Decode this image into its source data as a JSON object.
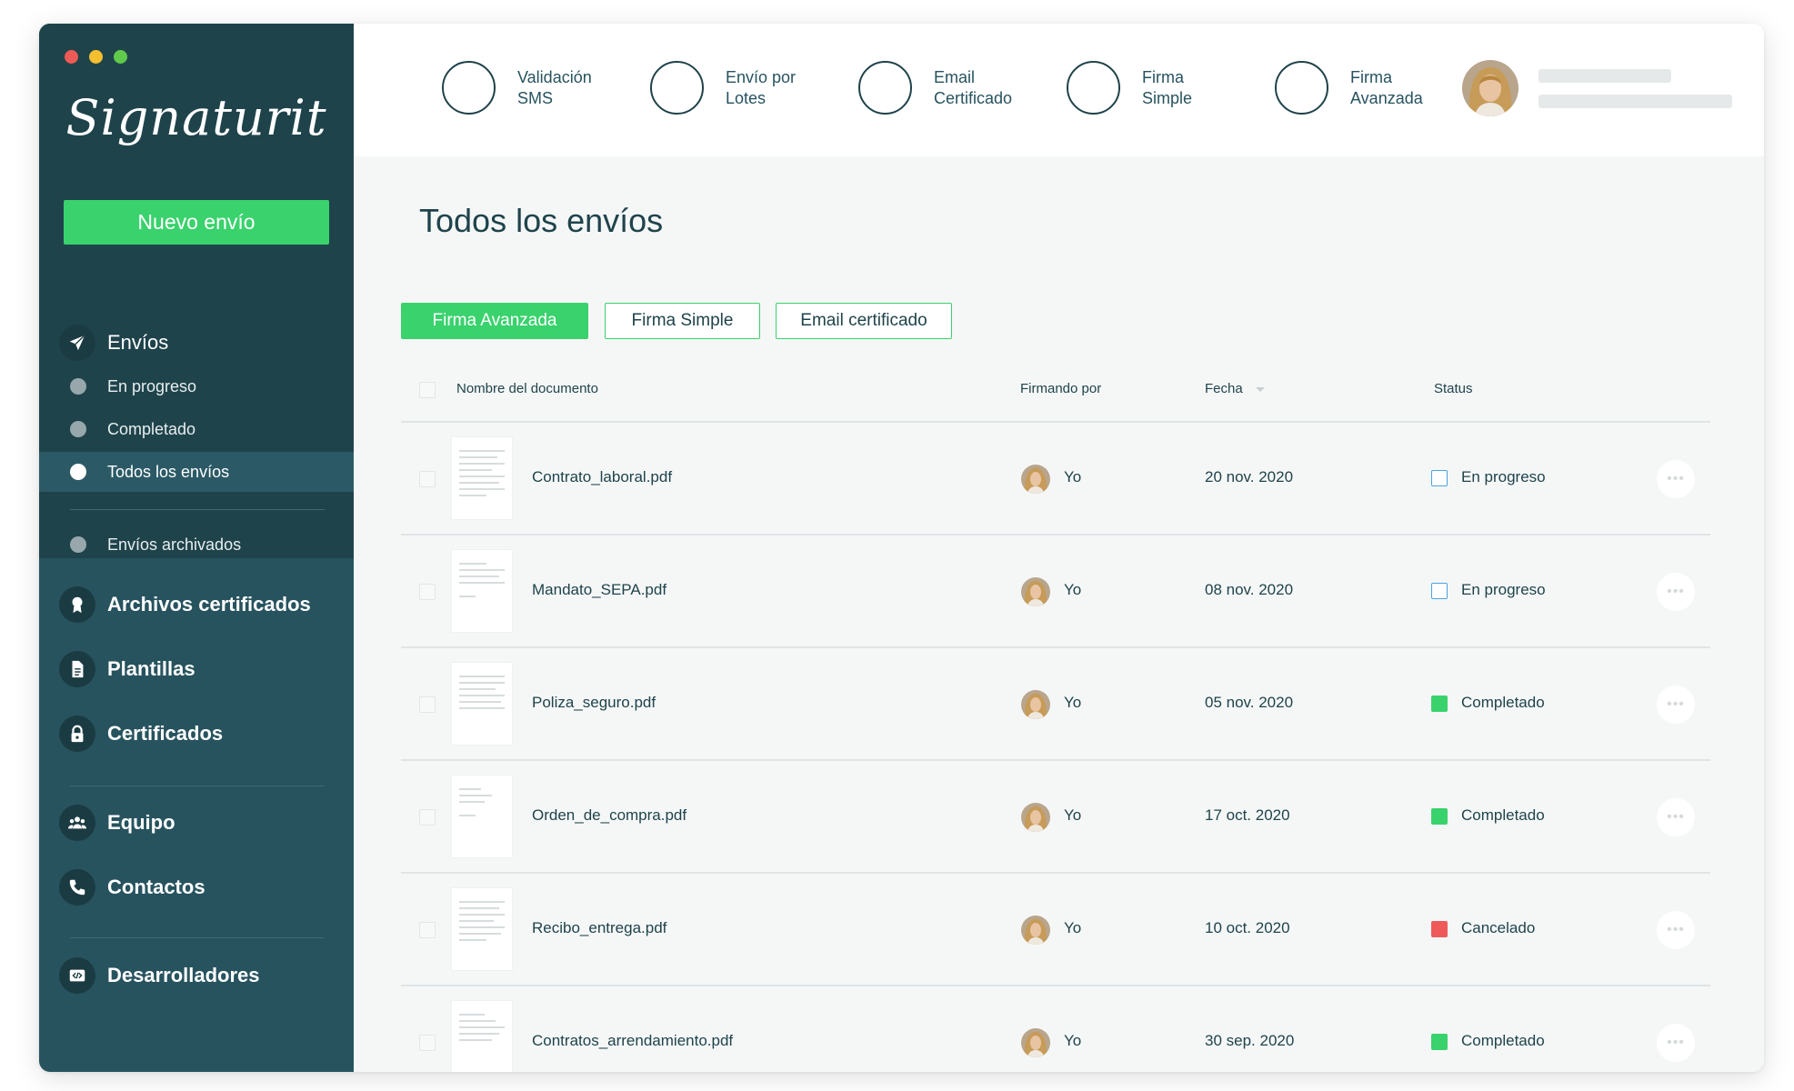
{
  "window": {
    "traffic_lights": [
      "#ee5a55",
      "#f5bf2f",
      "#5fc94c"
    ]
  },
  "sidebar": {
    "logo": "Signaturit",
    "new_button": "Nuevo envío",
    "envios": {
      "label": "Envíos",
      "icon": "paper-plane-icon",
      "sub": [
        {
          "label": "En progreso",
          "active": false
        },
        {
          "label": "Completado",
          "active": false
        },
        {
          "label": "Todos los envíos",
          "active": true
        },
        {
          "label": "Envíos archivados",
          "active": false
        }
      ]
    },
    "items": [
      {
        "label": "Archivos certificados",
        "icon": "award-icon"
      },
      {
        "label": "Plantillas",
        "icon": "document-icon"
      },
      {
        "label": "Certificados",
        "icon": "lock-icon"
      },
      {
        "label": "Equipo",
        "icon": "team-icon"
      },
      {
        "label": "Contactos",
        "icon": "phone-icon"
      },
      {
        "label": "Desarrolladores",
        "icon": "code-icon"
      }
    ]
  },
  "topbar": {
    "features": [
      {
        "line1": "Validación",
        "line2": "SMS"
      },
      {
        "line1": "Envío por",
        "line2": "Lotes"
      },
      {
        "line1": "Email",
        "line2": "Certificado"
      },
      {
        "line1": "Firma",
        "line2": "Simple"
      },
      {
        "line1": "Firma",
        "line2": "Avanzada"
      }
    ]
  },
  "main": {
    "title": "Todos los envíos",
    "filters": [
      {
        "label": "Firma Avanzada",
        "active": true
      },
      {
        "label": "Firma Simple",
        "active": false
      },
      {
        "label": "Email certificado",
        "active": false
      }
    ],
    "columns": {
      "name": "Nombre del documento",
      "signer": "Firmando por",
      "date": "Fecha",
      "status": "Status"
    },
    "rows": [
      {
        "name": "Contrato_laboral.pdf",
        "signer": "Yo",
        "date": "20 nov. 2020",
        "status": "En progreso",
        "state": "progress"
      },
      {
        "name": "Mandato_SEPA.pdf",
        "signer": "Yo",
        "date": "08 nov. 2020",
        "status": "En progreso",
        "state": "progress"
      },
      {
        "name": "Poliza_seguro.pdf",
        "signer": "Yo",
        "date": "05 nov. 2020",
        "status": "Completado",
        "state": "done"
      },
      {
        "name": "Orden_de_compra.pdf",
        "signer": "Yo",
        "date": "17 oct. 2020",
        "status": "Completado",
        "state": "done"
      },
      {
        "name": "Recibo_entrega.pdf",
        "signer": "Yo",
        "date": "10 oct. 2020",
        "status": "Cancelado",
        "state": "cancel"
      },
      {
        "name": "Contratos_arrendamiento.pdf",
        "signer": "Yo",
        "date": "30 sep. 2020",
        "status": "Completado",
        "state": "done"
      }
    ]
  },
  "colors": {
    "accent": "#39d26d",
    "progress": "#4aa3df",
    "done": "#39d26d",
    "cancel": "#ee5a5a"
  }
}
